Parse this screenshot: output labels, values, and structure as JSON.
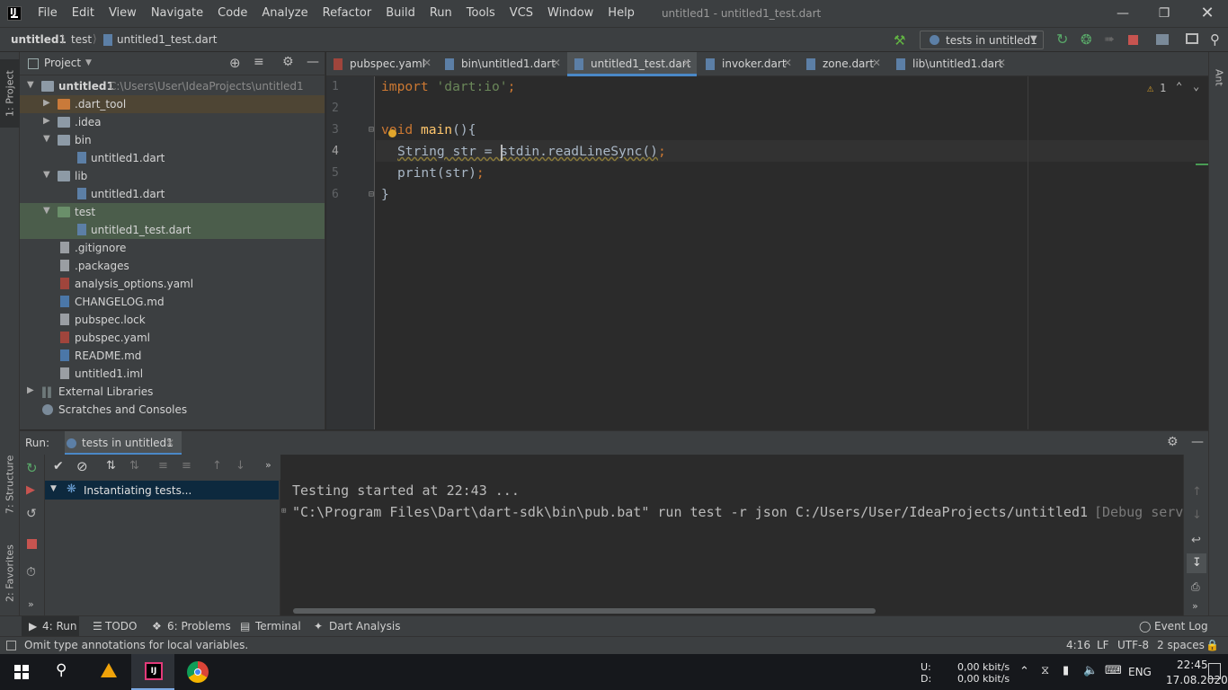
{
  "menubar": {
    "items": [
      "File",
      "Edit",
      "View",
      "Navigate",
      "Code",
      "Analyze",
      "Refactor",
      "Build",
      "Run",
      "Tools",
      "VCS",
      "Window",
      "Help"
    ],
    "window_title": "untitled1 - untitled1_test.dart"
  },
  "navbar": {
    "breadcrumbs": [
      "untitled1",
      "test",
      "untitled1_test.dart"
    ],
    "run_config": "tests in untitled1"
  },
  "left_strip": {
    "project_tab": "1: Project",
    "structure_tab": "7: Structure",
    "favorites_tab": "2: Favorites"
  },
  "right_strip": {
    "ant_tab": "Ant"
  },
  "project_panel": {
    "title": "Project",
    "tree": [
      {
        "label": "untitled1",
        "sub": "C:\\Users\\User\\IdeaProjects\\untitled1"
      },
      {
        "label": ".dart_tool"
      },
      {
        "label": ".idea"
      },
      {
        "label": "bin"
      },
      {
        "label": "untitled1.dart"
      },
      {
        "label": "lib"
      },
      {
        "label": "untitled1.dart"
      },
      {
        "label": "test"
      },
      {
        "label": "untitled1_test.dart"
      },
      {
        "label": ".gitignore"
      },
      {
        "label": ".packages"
      },
      {
        "label": "analysis_options.yaml"
      },
      {
        "label": "CHANGELOG.md"
      },
      {
        "label": "pubspec.lock"
      },
      {
        "label": "pubspec.yaml"
      },
      {
        "label": "README.md"
      },
      {
        "label": "untitled1.iml"
      },
      {
        "label": "External Libraries"
      },
      {
        "label": "Scratches and Consoles"
      }
    ]
  },
  "editor_tabs": [
    "pubspec.yaml",
    "bin\\untitled1.dart",
    "untitled1_test.dart",
    "invoker.dart",
    "zone.dart",
    "lib\\untitled1.dart"
  ],
  "editor": {
    "line_numbers": [
      "1",
      "2",
      "3",
      "4",
      "5",
      "6"
    ],
    "code": {
      "l1_kw": "import",
      "l1_str": "'dart:io'",
      "l1_end": ";",
      "l3_kw": "void",
      "l3_fn": "main",
      "l3_end": "(){",
      "l4_a": "String str = ",
      "l4_b": "stdin.readLineSync()",
      "l4_end": ";",
      "l5": "print(str)",
      "l5_end": ";",
      "l6": "}"
    },
    "warning_count": "1"
  },
  "run_panel": {
    "label": "Run:",
    "tab": "tests in untitled1",
    "tree_item": "Instantiating tests...",
    "console": [
      "Testing started at 22:43 ...",
      "\"C:\\Program Files\\Dart\\dart-sdk\\bin\\pub.bat\" run test -r json C:/Users/User/IdeaProjects/untitled1"
    ],
    "console_hint": "[Debug serv"
  },
  "bottom_tabs": {
    "run": "4: Run",
    "todo": "TODO",
    "problems": "6: Problems",
    "terminal": "Terminal",
    "dart_analysis": "Dart Analysis",
    "event_log": "Event Log"
  },
  "statusbar": {
    "message": "Omit type annotations for local variables.",
    "position": "4:16",
    "line_sep": "LF",
    "encoding": "UTF-8",
    "indent": "2 spaces"
  },
  "taskbar": {
    "net_u_label": "U:",
    "net_d_label": "D:",
    "net_u": "0,00 kbit/s",
    "net_d": "0,00 kbit/s",
    "lang": "ENG",
    "time": "22:45",
    "date": "17.08.2020"
  }
}
